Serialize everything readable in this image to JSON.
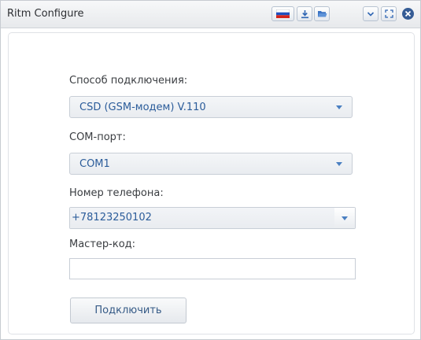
{
  "window": {
    "title": "Ritm Configure"
  },
  "titlebar_icons": [
    "russian-flag-icon",
    "download-icon",
    "folder-open-icon",
    "chevron-down-icon",
    "expand-icon",
    "close-icon"
  ],
  "form": {
    "connection_method": {
      "label": "Способ подключения:",
      "value": "CSD (GSM-модем) V.110"
    },
    "com_port": {
      "label": "COM-порт:",
      "value": "COM1"
    },
    "phone_number": {
      "label": "Номер телефона:",
      "value": "+78123250102"
    },
    "master_code": {
      "label": "Мастер-код:",
      "value": ""
    },
    "connect_button": "Подключить"
  },
  "colors": {
    "accent": "#2b5c9a",
    "close": "#355c95"
  }
}
